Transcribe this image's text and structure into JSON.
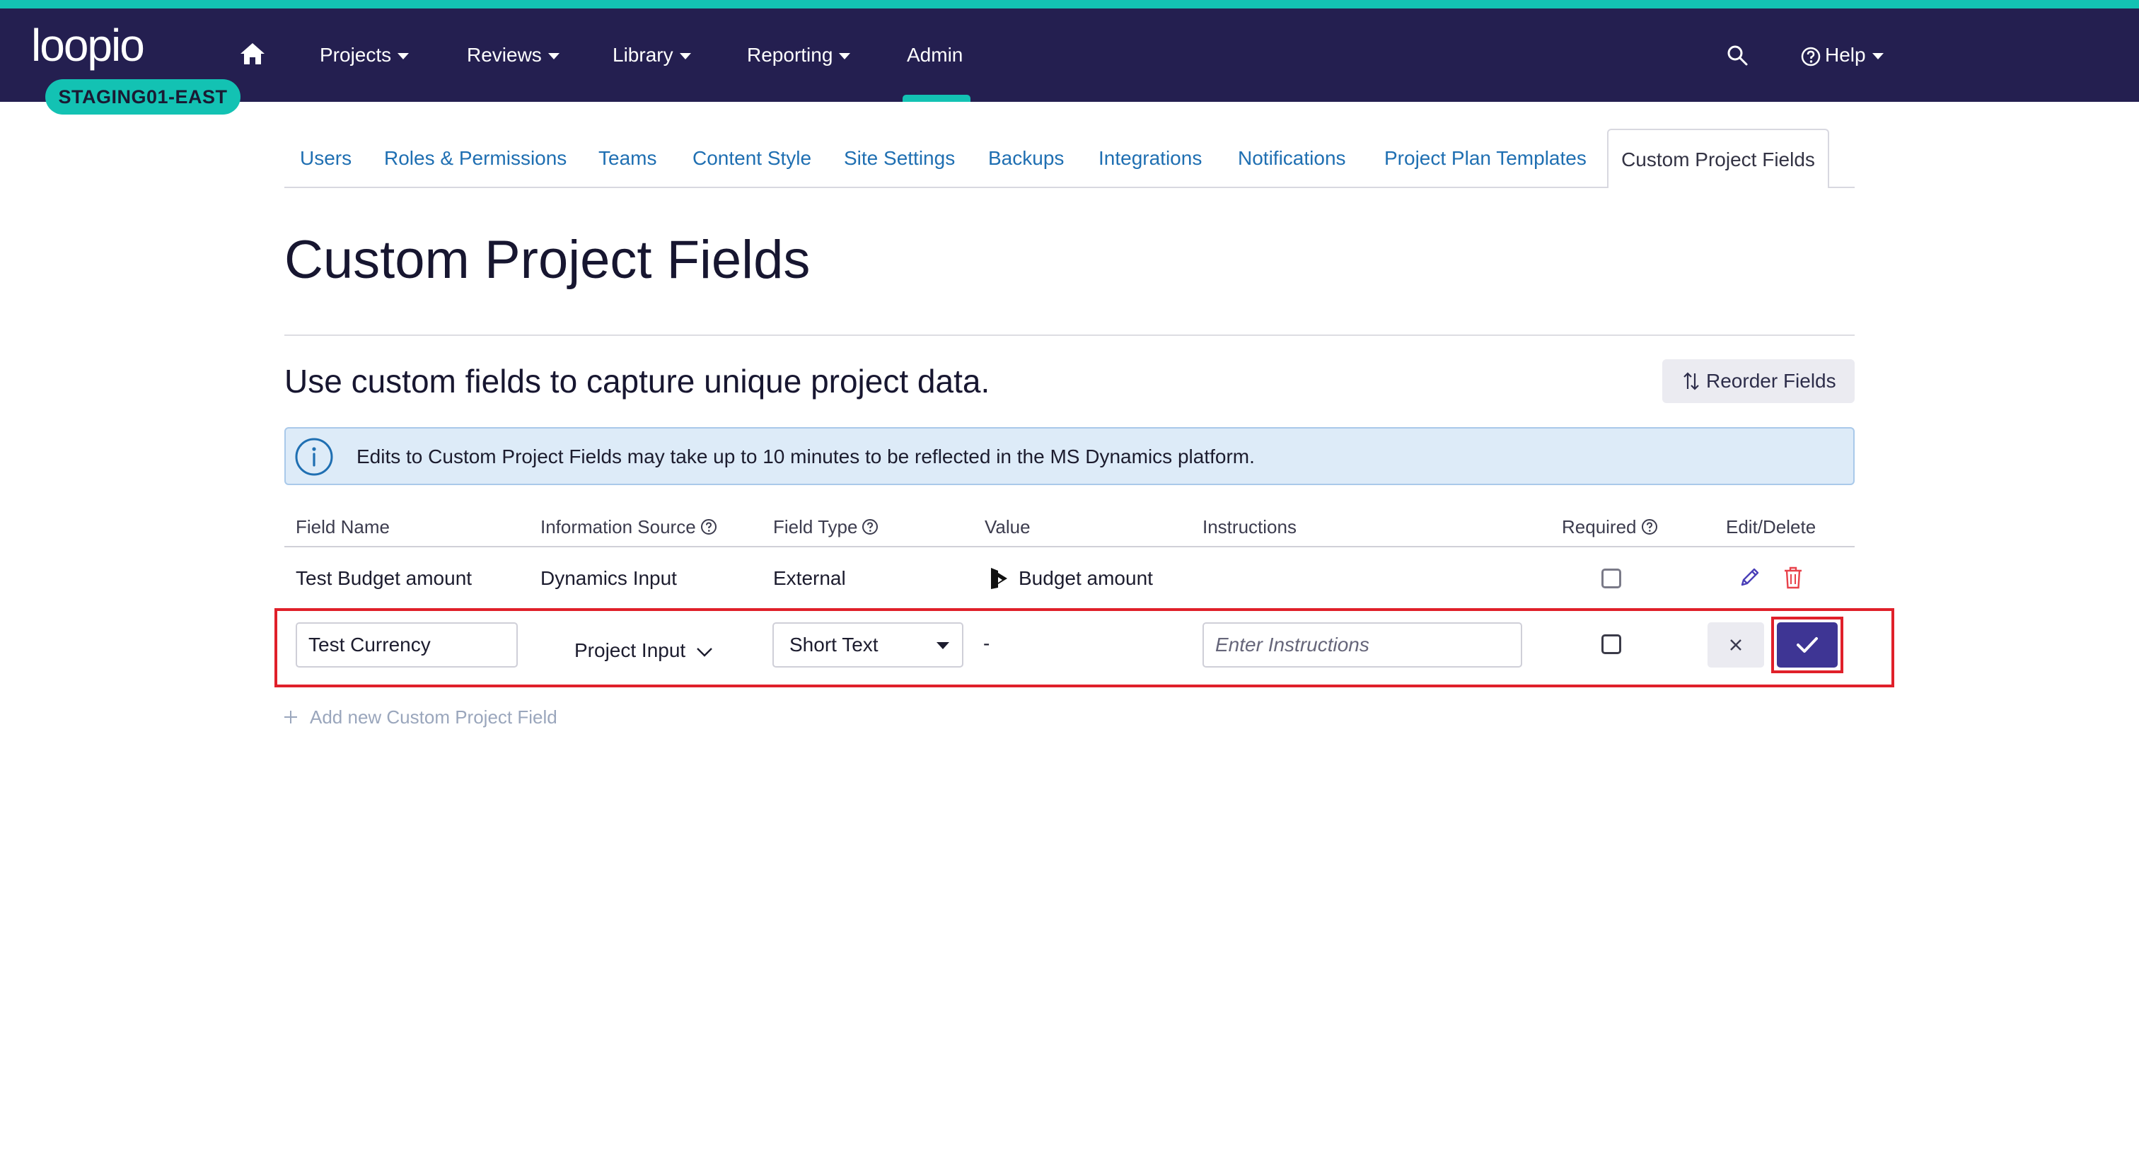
{
  "app": {
    "logo_text": "loopio",
    "environment_badge": "STAGING01-EAST"
  },
  "nav": {
    "items": [
      {
        "label": "Projects",
        "has_dropdown": true
      },
      {
        "label": "Reviews",
        "has_dropdown": true
      },
      {
        "label": "Library",
        "has_dropdown": true
      },
      {
        "label": "Reporting",
        "has_dropdown": true
      },
      {
        "label": "Admin",
        "active": true
      }
    ],
    "help_label": "Help"
  },
  "subtabs": {
    "items": [
      "Users",
      "Roles & Permissions",
      "Teams",
      "Content Style",
      "Site Settings",
      "Backups",
      "Integrations",
      "Notifications",
      "Project Plan Templates"
    ],
    "active": "Custom Project Fields"
  },
  "page": {
    "title": "Custom Project Fields",
    "subtitle": "Use custom fields to capture unique project data.",
    "reorder_label": "Reorder Fields"
  },
  "banner": {
    "text": "Edits to Custom Project Fields may take up to 10 minutes to be reflected in the MS Dynamics platform."
  },
  "table": {
    "columns": [
      "Field Name",
      "Information Source",
      "Field Type",
      "Value",
      "Instructions",
      "Required",
      "Edit/Delete"
    ],
    "rows": [
      {
        "field_name": "Test Budget amount",
        "information_source": "Dynamics Input",
        "field_type": "External",
        "value": "Budget amount",
        "instructions": "",
        "required": false
      }
    ],
    "edit_row": {
      "field_name_value": "Test Currency",
      "information_source": "Project Input",
      "field_type": "Short Text",
      "value": "-",
      "instructions_placeholder": "Enter Instructions",
      "required": false
    },
    "add_new_label": "Add new Custom Project Field"
  },
  "colors": {
    "nav_bg": "#241f50",
    "accent_teal": "#13c2b3",
    "link_blue": "#1f6fb2",
    "primary_button": "#3e3594",
    "highlight_red": "#e0202a",
    "banner_bg": "#ddebf8",
    "delete_red": "#e8424b"
  }
}
